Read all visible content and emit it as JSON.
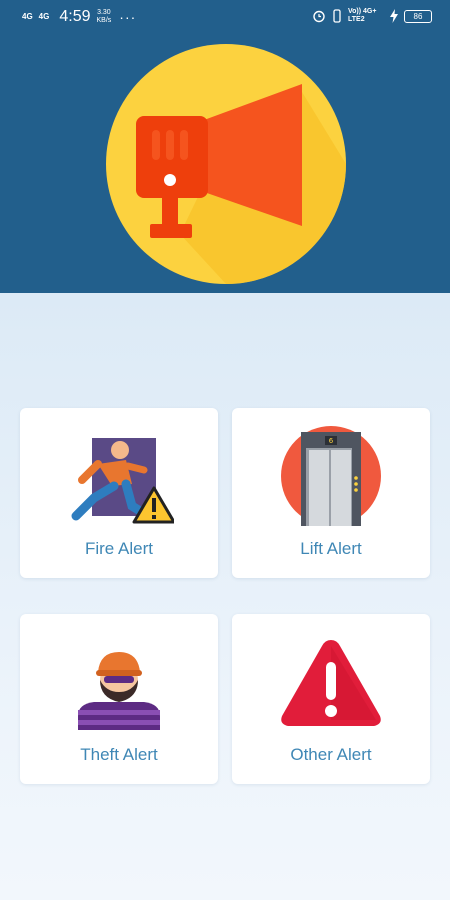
{
  "status_bar": {
    "net1": "4G",
    "net2": "4G",
    "time": "4:59",
    "speed": "3.30",
    "speed_unit": "KB/s",
    "more": "···",
    "carrier": "Vo)) 4G+ LTE2",
    "battery": "86"
  },
  "colors": {
    "header_bg": "#225f8c",
    "label_text": "#3f87b5",
    "card_bg": "#ffffff"
  },
  "cards": [
    {
      "label": "Fire Alert",
      "icon": "fire-exit-icon"
    },
    {
      "label": "Lift Alert",
      "icon": "elevator-icon"
    },
    {
      "label": "Theft Alert",
      "icon": "thief-icon"
    },
    {
      "label": "Other Alert",
      "icon": "warning-triangle-icon"
    }
  ]
}
